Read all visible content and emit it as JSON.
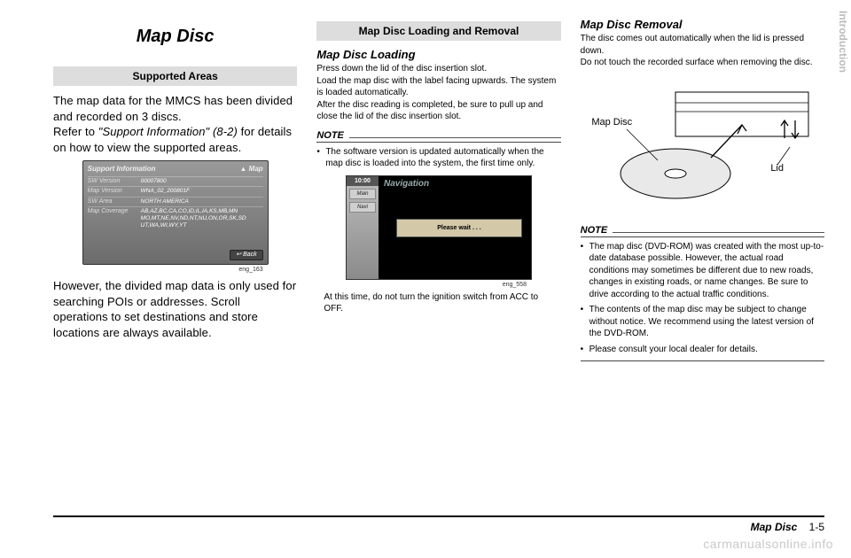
{
  "page": {
    "title": "Map Disc",
    "side_tab_light": "Introduction",
    "footer_title": "Map Disc",
    "footer_page": "1-5",
    "watermark": "carmanualsonline.info"
  },
  "col1": {
    "section_bar": "Supported Areas",
    "p1a": "The map data for the MMCS has been divided and recorded on 3 discs.",
    "p1b_pre": "Refer to ",
    "p1b_ital": "\"Support Information\" (8-2)",
    "p1b_post": " for details on how to view the supported areas.",
    "shot": {
      "title": "Support Information",
      "map_btn": "▲ Map",
      "rows": [
        {
          "k": "SW Version",
          "v": "00007800"
        },
        {
          "k": "Map Version",
          "v": "WNA_02_200801F"
        },
        {
          "k": "SW Area",
          "v": "NORTH AMERICA"
        },
        {
          "k": "Map Coverage",
          "v": "AB,AZ,BC,CA,CO,ID,IL,IA,KS,MB,MN MO,MT,NE,NV,ND,NT,NU,ON,OR,SK,SD UT,WA,WI,WY,YT"
        }
      ],
      "back_btn": "↩ Back",
      "caption": "eng_163"
    },
    "p2": "However, the divided map data is only used for searching POIs or addresses. Scroll operations to set destinations and store locations are always available."
  },
  "col2": {
    "section_bar": "Map Disc Loading and Removal",
    "sub_loading": "Map Disc Loading",
    "loading_p1": "Press down the lid of the disc insertion slot.",
    "loading_p2": "Load the map disc with the label facing upwards. The system is loaded automatically.",
    "loading_p3": "After the disc reading is completed, be sure to pull up and close the lid of the disc insertion slot.",
    "note_label": "NOTE",
    "note1": "The software version is updated automatically when the map disc is loaded into the system, the first time only.",
    "shot": {
      "clock": "10:00",
      "nav": "Navigation",
      "tab_main": "Main",
      "tab_navi": "Navi",
      "msg": "Please wait . . .",
      "caption": "eng_558"
    },
    "caption_text": "At this time, do not turn the ignition switch from ACC to OFF."
  },
  "col3": {
    "sub_removal": "Map Disc Removal",
    "removal_p1": "The disc comes out automatically when the lid is pressed down.",
    "removal_p2": "Do not touch the recorded surface when removing the disc.",
    "fig": {
      "label_disc": "Map Disc",
      "label_lid": "Lid"
    },
    "note_label": "NOTE",
    "notes": [
      "The map disc (DVD-ROM) was created with the most up-to-date database possible.\nHowever, the actual road conditions may sometimes be different due to new roads, changes in existing roads, or name changes. Be sure to drive according to the actual traffic conditions.",
      "The contents of the map disc may be subject to change without notice.\nWe recommend using the latest version of the DVD-ROM.",
      "Please consult your local dealer for details."
    ]
  }
}
